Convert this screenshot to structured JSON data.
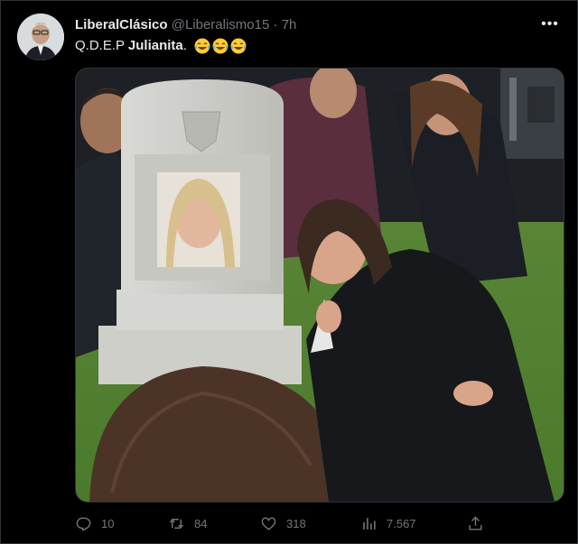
{
  "tweet": {
    "display_name": "LiberalClásico",
    "handle": "@Liberalismo15",
    "separator": "·",
    "time": "7h",
    "text_prefix": "Q.D.E.P ",
    "text_bold": "Julianita",
    "text_suffix": ".",
    "emoji_names": [
      "face-with-tears-of-joy-emoji",
      "face-with-tears-of-joy-emoji",
      "face-with-tears-of-joy-emoji"
    ],
    "more_icon": "more-horizontal-icon"
  },
  "actions": {
    "replies": "10",
    "retweets": "84",
    "likes": "318",
    "views": "7.567"
  },
  "colors": {
    "background": "#000000",
    "text": "#e7e9ea",
    "secondary": "#71767b",
    "border": "#2f3336"
  }
}
